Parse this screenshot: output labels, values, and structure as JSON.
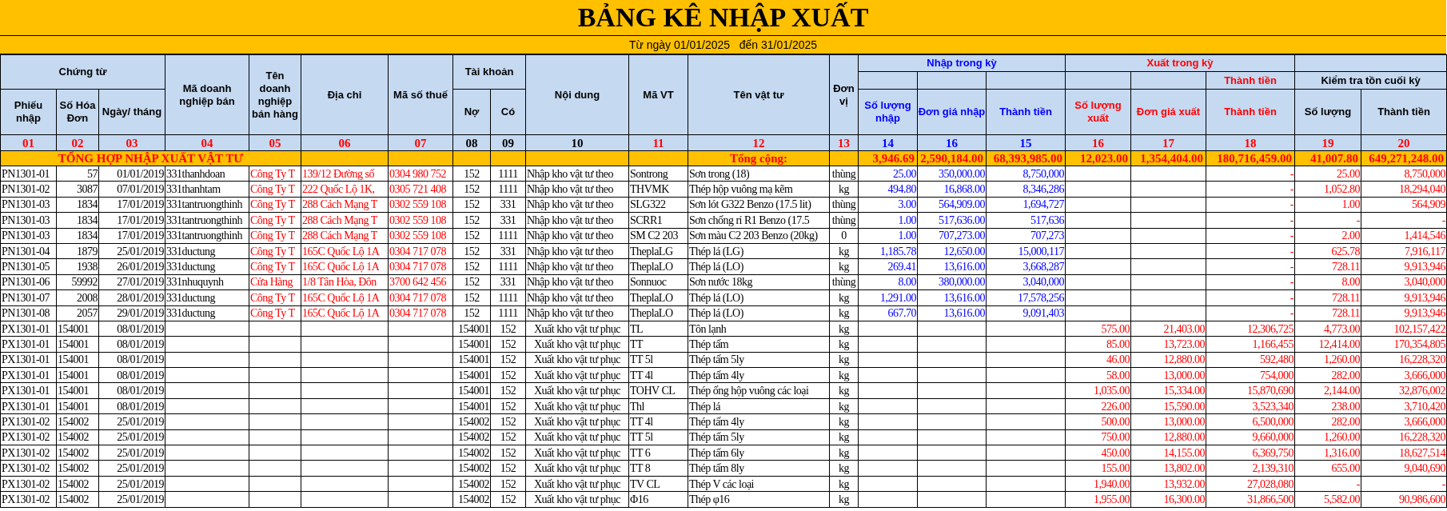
{
  "title": "BẢNG KÊ NHẬP XUẤT",
  "date_range": "Từ ngày 01/01/2025   đến 31/01/2025",
  "header": {
    "row_1": [
      "Chứng từ",
      "Mã doanh nghiệp bán",
      "Tên doanh nghiệp bán hàng",
      "Địa chỉ",
      "Mã số thuế",
      "Tài khoản",
      "Nội dung",
      "Mã VT",
      "Tên vật tư",
      "Đơn vị",
      "Nhập trong kỳ",
      "Xuất trong kỳ"
    ],
    "row_2": [
      "Thành tiền",
      "Kiểm tra tồn cuối kỳ"
    ],
    "row_3": [
      "Phiếu nhập",
      "Số Hóa Đơn",
      "Ngày/ tháng",
      "Nợ",
      "Có",
      "Số lượng nhập",
      "Đơn giá nhập",
      "Thành tiền",
      "Số lượng xuất",
      "Đơn giá xuất",
      "Thành tiền",
      "Số lượng",
      "Thành tiền"
    ]
  },
  "columns": [
    {
      "code": "01",
      "kind": "doc"
    },
    {
      "code": "02",
      "kind": "doc"
    },
    {
      "code": "03",
      "kind": "doc"
    },
    {
      "code": "04",
      "kind": "doc"
    },
    {
      "code": "05",
      "kind": "vendor"
    },
    {
      "code": "06",
      "kind": "vendor"
    },
    {
      "code": "07",
      "kind": "vendor"
    },
    {
      "code": "08",
      "kind": "account"
    },
    {
      "code": "09",
      "kind": "account"
    },
    {
      "code": "10",
      "kind": "account"
    },
    {
      "code": "11",
      "kind": "item"
    },
    {
      "code": "12",
      "kind": "item"
    },
    {
      "code": "13",
      "kind": "item"
    },
    {
      "code": "14",
      "kind": "in"
    },
    {
      "code": "16",
      "kind": "in"
    },
    {
      "code": "15",
      "kind": "in"
    },
    {
      "code": "16",
      "kind": "out"
    },
    {
      "code": "17",
      "kind": "out"
    },
    {
      "code": "18",
      "kind": "out"
    },
    {
      "code": "19",
      "kind": "stock"
    },
    {
      "code": "20",
      "kind": "stock"
    }
  ],
  "total_row": {
    "label": "TỔNG HỢP NHẬP XUẤT VẬT TƯ",
    "sum_label": "Tổng cộng:",
    "values": [
      "3,946.69",
      "2,590,184.00",
      "68,393,985.00",
      "12,023.00",
      "1,354,404.00",
      "180,716,459.00",
      "41,007.80",
      "649,271,248.00"
    ]
  },
  "rows": [
    {
      "kind": "receipt",
      "cells": [
        "PN1301-01",
        "57",
        "01/01/2019",
        "331thanhdoan",
        "Công Ty T",
        "139/12 Đường số",
        "0304 980 752",
        "152",
        "1111",
        "Nhập kho vật tư theo",
        "Sontrong",
        "Sơn trong (18)",
        "thùng",
        "25.00",
        "350,000.00",
        "8,750,000",
        null,
        null,
        "-",
        "25.00",
        "8,750,000"
      ]
    },
    {
      "kind": "receipt",
      "cells": [
        "PN1301-02",
        "3087",
        "07/01/2019",
        "331thanhtam",
        "Công Ty T",
        "222 Quốc Lộ 1K,",
        "0305 721 408",
        "152",
        "1111",
        "Nhập kho vật tư theo",
        "THVMK",
        "Thép hộp vuông mạ kẽm",
        "kg",
        "494.80",
        "16,868.00",
        "8,346,286",
        null,
        null,
        "-",
        "1,052.80",
        "18,294,040"
      ]
    },
    {
      "kind": "receipt",
      "cells": [
        "PN1301-03",
        "1834",
        "17/01/2019",
        "331tantruongthinh",
        "Công Ty T",
        "288 Cách Mạng T",
        "0302 559 108",
        "152",
        "331",
        "Nhập kho vật tư theo",
        "SLG322",
        "Sơn lót G322 Benzo (17.5 lit)",
        "thùng",
        "3.00",
        "564,909.00",
        "1,694,727",
        null,
        null,
        "-",
        "1.00",
        "564,909"
      ]
    },
    {
      "kind": "receipt",
      "cells": [
        "PN1301-03",
        "1834",
        "17/01/2019",
        "331tantruongthinh",
        "Công Ty T",
        "288 Cách Mạng T",
        "0302 559 108",
        "152",
        "331",
        "Nhập kho vật tư theo",
        "SCRR1",
        "Sơn chống rỉ R1 Benzo (17.5",
        "thùng",
        "1.00",
        "517,636.00",
        "517,636",
        null,
        null,
        "-",
        "-",
        "-"
      ]
    },
    {
      "kind": "receipt",
      "cells": [
        "PN1301-03",
        "1834",
        "17/01/2019",
        "331tantruongthinh",
        "Công Ty T",
        "288 Cách Mạng T",
        "0302 559 108",
        "152",
        "1111",
        "Nhập kho vật tư theo",
        "SM C2 203",
        "Sơn màu C2 203 Benzo (20kg)",
        "0",
        "1.00",
        "707,273.00",
        "707,273",
        null,
        null,
        "-",
        "2.00",
        "1,414,546"
      ]
    },
    {
      "kind": "receipt",
      "cells": [
        "PN1301-04",
        "1879",
        "25/01/2019",
        "331ductung",
        "Công Ty T",
        "165C Quốc Lộ 1A",
        "0304 717 078",
        "152",
        "331",
        "Nhập kho vật tư theo",
        "TheplaLG",
        "Thép lá (LG)",
        "kg",
        "1,185.78",
        "12,650.00",
        "15,000,117",
        null,
        null,
        "-",
        "625.78",
        "7,916,117"
      ]
    },
    {
      "kind": "receipt",
      "cells": [
        "PN1301-05",
        "1938",
        "26/01/2019",
        "331ductung",
        "Công Ty T",
        "165C Quốc Lộ 1A",
        "0304 717 078",
        "152",
        "1111",
        "Nhập kho vật tư theo",
        "TheplaLO",
        "Thép lá (LO)",
        "kg",
        "269.41",
        "13,616.00",
        "3,668,287",
        null,
        null,
        "-",
        "728.11",
        "9,913,946"
      ]
    },
    {
      "kind": "receipt",
      "cells": [
        "PN1301-06",
        "59992",
        "27/01/2019",
        "331nhuquynh",
        "Cửa Hàng",
        "1/8 Tân Hòa, Đôn",
        "3700 642 456",
        "152",
        "331",
        "Nhập kho vật tư theo",
        "Sonnuoc",
        "Sơn nước 18kg",
        "thùng",
        "8.00",
        "380,000.00",
        "3,040,000",
        null,
        null,
        "-",
        "8.00",
        "3,040,000"
      ]
    },
    {
      "kind": "receipt",
      "cells": [
        "PN1301-07",
        "2008",
        "28/01/2019",
        "331ductung",
        "Công Ty T",
        "165C Quốc Lộ 1A",
        "0304 717 078",
        "152",
        "1111",
        "Nhập kho vật tư theo",
        "TheplaLO",
        "Thép lá (LO)",
        "kg",
        "1,291.00",
        "13,616.00",
        "17,578,256",
        null,
        null,
        "-",
        "728.11",
        "9,913,946"
      ]
    },
    {
      "kind": "receipt",
      "cells": [
        "PN1301-08",
        "2057",
        "29/01/2019",
        "331ductung",
        "Công Ty T",
        "165C Quốc Lộ 1A",
        "0304 717 078",
        "152",
        "1111",
        "Nhập kho vật tư theo",
        "TheplaLO",
        "Thép lá (LO)",
        "kg",
        "667.70",
        "13,616.00",
        "9,091,403",
        null,
        null,
        "-",
        "728.11",
        "9,913,946"
      ]
    },
    {
      "kind": "issue",
      "cells": [
        "PX1301-01",
        "154001",
        "08/01/2019",
        null,
        null,
        null,
        null,
        "154001",
        "152",
        "Xuất kho vật tư phục",
        "TL",
        "Tôn lạnh",
        "kg",
        null,
        null,
        null,
        "575.00",
        "21,403.00",
        "12,306,725",
        "4,773.00",
        "102,157,422"
      ]
    },
    {
      "kind": "issue",
      "cells": [
        "PX1301-01",
        "154001",
        "08/01/2019",
        null,
        null,
        null,
        null,
        "154001",
        "152",
        "Xuất kho vật tư phục",
        "TT",
        "Thép tấm",
        "kg",
        null,
        null,
        null,
        "85.00",
        "13,723.00",
        "1,166,455",
        "12,414.00",
        "170,354,805"
      ]
    },
    {
      "kind": "issue",
      "cells": [
        "PX1301-01",
        "154001",
        "08/01/2019",
        null,
        null,
        null,
        null,
        "154001",
        "152",
        "Xuất kho vật tư phục",
        "TT 5l",
        "Thép tấm 5ly",
        "kg",
        null,
        null,
        null,
        "46.00",
        "12,880.00",
        "592,480",
        "1,260.00",
        "16,228,320"
      ]
    },
    {
      "kind": "issue",
      "cells": [
        "PX1301-01",
        "154001",
        "08/01/2019",
        null,
        null,
        null,
        null,
        "154001",
        "152",
        "Xuất kho vật tư phục",
        "TT 4l",
        "Thép tấm  4ly",
        "kg",
        null,
        null,
        null,
        "58.00",
        "13,000.00",
        "754,000",
        "282.00",
        "3,666,000"
      ]
    },
    {
      "kind": "issue",
      "cells": [
        "PX1301-01",
        "154001",
        "08/01/2019",
        null,
        null,
        null,
        null,
        "154001",
        "152",
        "Xuất kho vật tư phục",
        "TOHV CL",
        "Thép ống hộp vuông các loại",
        "kg",
        null,
        null,
        null,
        "1,035.00",
        "15,334.00",
        "15,870,690",
        "2,144.00",
        "32,876,002"
      ]
    },
    {
      "kind": "issue",
      "cells": [
        "PX1301-01",
        "154001",
        "08/01/2019",
        null,
        null,
        null,
        null,
        "154001",
        "152",
        "Xuất kho vật tư phục",
        "Thl",
        "Thép lá",
        "kg",
        null,
        null,
        null,
        "226.00",
        "15,590.00",
        "3,523,340",
        "238.00",
        "3,710,420"
      ]
    },
    {
      "kind": "issue",
      "cells": [
        "PX1301-02",
        "154002",
        "25/01/2019",
        null,
        null,
        null,
        null,
        "154002",
        "152",
        "Xuất kho vật tư phục",
        "TT 4l",
        "Thép tấm  4ly",
        "kg",
        null,
        null,
        null,
        "500.00",
        "13,000.00",
        "6,500,000",
        "282.00",
        "3,666,000"
      ]
    },
    {
      "kind": "issue",
      "cells": [
        "PX1301-02",
        "154002",
        "25/01/2019",
        null,
        null,
        null,
        null,
        "154002",
        "152",
        "Xuất kho vật tư phục",
        "TT 5l",
        "Thép tấm 5ly",
        "kg",
        null,
        null,
        null,
        "750.00",
        "12,880.00",
        "9,660,000",
        "1,260.00",
        "16,228,320"
      ]
    },
    {
      "kind": "issue",
      "cells": [
        "PX1301-02",
        "154002",
        "25/01/2019",
        null,
        null,
        null,
        null,
        "154002",
        "152",
        "Xuất kho vật tư phục",
        "TT 6",
        "Thép tấm 6ly",
        "kg",
        null,
        null,
        null,
        "450.00",
        "14,155.00",
        "6,369,750",
        "1,316.00",
        "18,627,514"
      ]
    },
    {
      "kind": "issue",
      "cells": [
        "PX1301-02",
        "154002",
        "25/01/2019",
        null,
        null,
        null,
        null,
        "154002",
        "152",
        "Xuất kho vật tư phục",
        "TT 8",
        "Thép tấm 8ly",
        "kg",
        null,
        null,
        null,
        "155.00",
        "13,802.00",
        "2,139,310",
        "655.00",
        "9,040,690"
      ]
    },
    {
      "kind": "issue",
      "cells": [
        "PX1301-02",
        "154002",
        "25/01/2019",
        null,
        null,
        null,
        null,
        "154002",
        "152",
        "Xuất kho vật tư phục",
        "TV CL",
        "Thép V các loại",
        "kg",
        null,
        null,
        null,
        "1,940.00",
        "13,932.00",
        "27,028,080",
        "-",
        "-"
      ]
    },
    {
      "kind": "issue",
      "cells": [
        "PX1301-02",
        "154002",
        "25/01/2019",
        null,
        null,
        null,
        null,
        "154002",
        "152",
        "Xuất kho vật tư phục",
        "Φ16",
        "Thép φ16",
        "kg",
        null,
        null,
        null,
        "1,955.00",
        "16,300.00",
        "31,866,500",
        "5,582.00",
        "90,986,600"
      ]
    }
  ]
}
